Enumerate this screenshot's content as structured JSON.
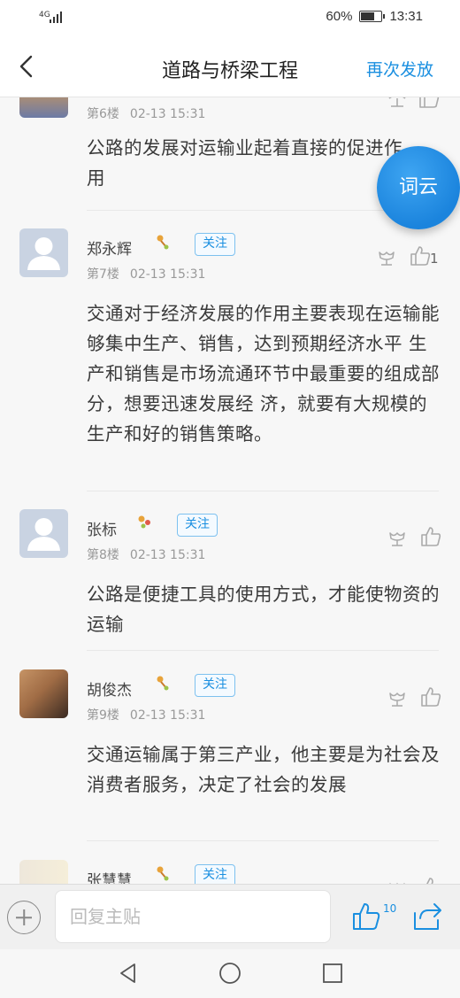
{
  "status_bar": {
    "network": "4G",
    "battery": "60%",
    "time": "13:31"
  },
  "header": {
    "title": "道路与桥梁工程",
    "repost_label": "再次发放"
  },
  "fab": {
    "label": "词云"
  },
  "posts": [
    {
      "author": "",
      "floor": "第6楼",
      "time": "02-13 15:31",
      "content": "公路的发展对运输业起着直接的促进作用",
      "likes": ""
    },
    {
      "author": "郑永辉",
      "follow_label": "关注",
      "floor": "第7楼",
      "time": "02-13 15:31",
      "content": "交通对于经济发展的作用主要表现在运输能够集中生产、销售，达到预期经济水平 生产和销售是市场流通环节中最重要的组成部分，想要迅速发展经 济，就要有大规模的生产和好的销售策略。",
      "likes": "1"
    },
    {
      "author": "张标",
      "follow_label": "关注",
      "floor": "第8楼",
      "time": "02-13 15:31",
      "content": "公路是便捷工具的使用方式，才能使物资的运输",
      "likes": ""
    },
    {
      "author": "胡俊杰",
      "follow_label": "关注",
      "floor": "第9楼",
      "time": "02-13 15:31",
      "content": "交通运输属于第三产业，他主要是为社会及消费者服务，决定了社会的发展",
      "likes": ""
    },
    {
      "author": "张慧慧",
      "follow_label": "关注"
    }
  ],
  "reply_bar": {
    "placeholder": "回复主贴",
    "like_count": "10"
  },
  "colors": {
    "accent": "#1a8fe0",
    "follow_border": "#7dc1ef"
  }
}
